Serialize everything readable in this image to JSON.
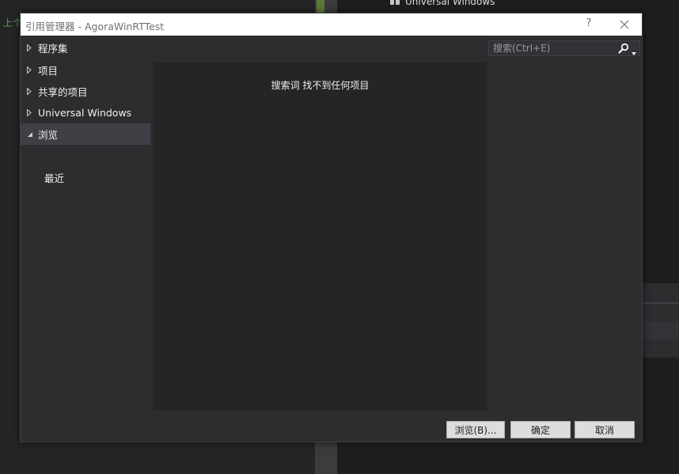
{
  "background": {
    "green_text": "上个",
    "tree_item_label": "Universal Windows"
  },
  "dialog": {
    "title": "引用管理器 - AgoraWinRTTest",
    "help_label": "?",
    "close_icon": "close-icon"
  },
  "nav": {
    "items": [
      {
        "label": "程序集",
        "expanded": false
      },
      {
        "label": "项目",
        "expanded": false
      },
      {
        "label": "共享的项目",
        "expanded": false
      },
      {
        "label": "Universal Windows",
        "expanded": false
      },
      {
        "label": "浏览",
        "expanded": true,
        "selected": true
      }
    ],
    "sub_item": "最近"
  },
  "content": {
    "empty_message": "搜索词  找不到任何项目"
  },
  "search": {
    "placeholder": "搜索(Ctrl+E)",
    "value": "",
    "icon": "search-icon"
  },
  "footer": {
    "browse_label": "浏览(B)...",
    "ok_label": "确定",
    "cancel_label": "取消"
  },
  "colors": {
    "dialog_bg": "#2d2d30",
    "content_bg": "#252526",
    "selected_bg": "#3f3f46",
    "titlebar_bg": "#ffffff",
    "green_text": "#57a64a"
  }
}
